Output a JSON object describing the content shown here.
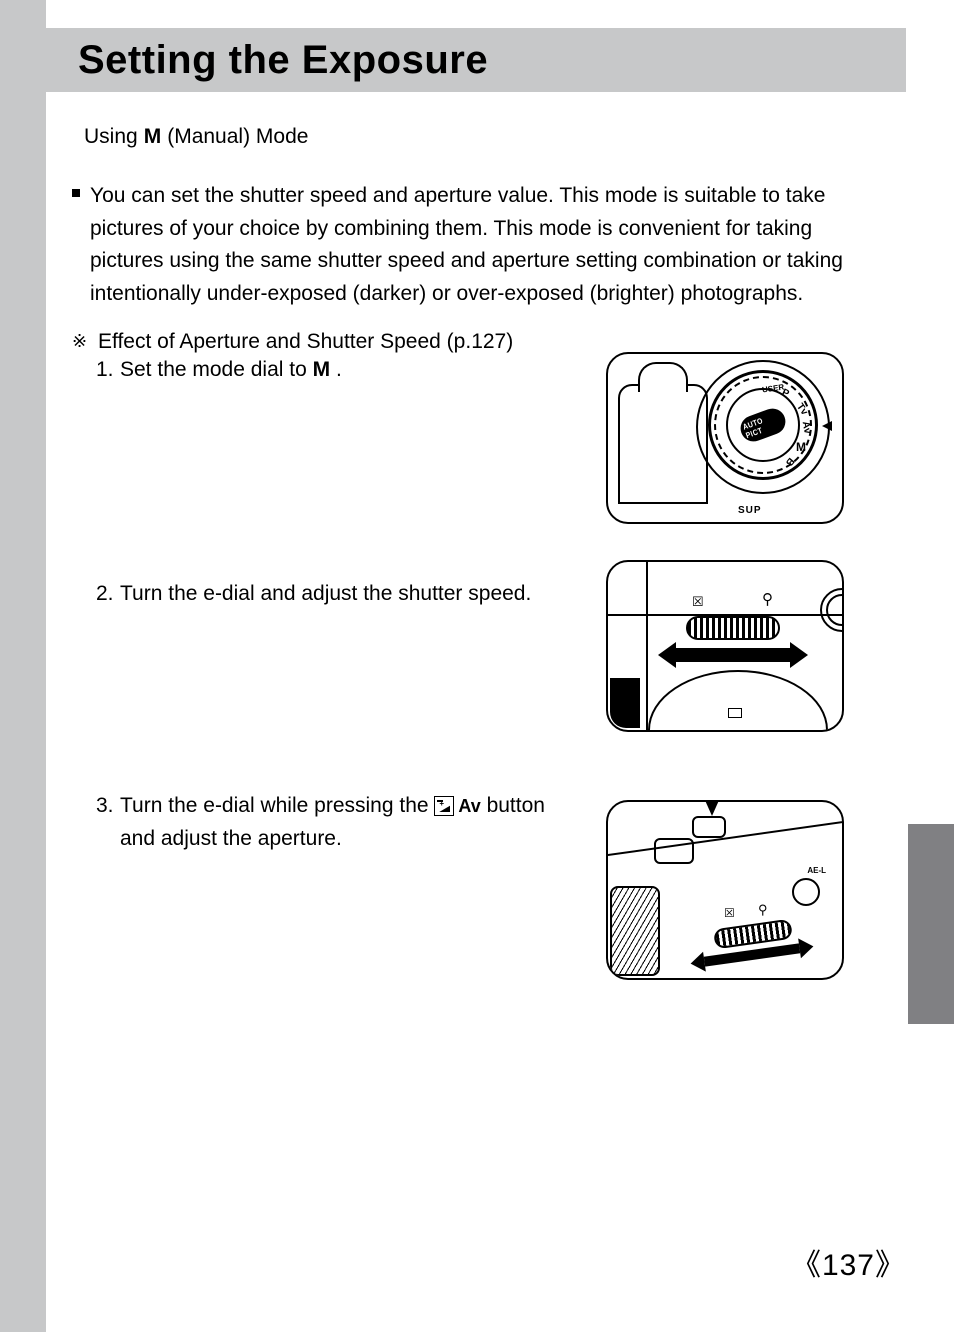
{
  "title": "Setting the Exposure",
  "subhead_prefix": "Using ",
  "subhead_mode_glyph": "M",
  "subhead_suffix": " (Manual) Mode",
  "bullet_main": "You can set the shutter speed and aperture value. This mode is suitable to take pictures of your choice by combining them. This mode is convenient for taking pictures using the same shutter speed and aperture setting combination or taking intentionally under-exposed (darker) or over-exposed (brighter) photographs.",
  "crossref_marker": "※",
  "crossref_text": "Effect of Aperture and Shutter Speed (p.127)",
  "steps": {
    "s1_num": "1.",
    "s1_a": "Set the mode dial to ",
    "s1_glyph": "M",
    "s1_b": " .",
    "s2_num": "2.",
    "s2_text": "Turn the e-dial and adjust the shutter speed.",
    "s3_num": "3.",
    "s3_a": "Turn the e-dial while pressing the ",
    "s3_av_label": "Av",
    "s3_b": " button and adjust the aperture."
  },
  "illus1": {
    "center": "AUTO PICT",
    "labels": {
      "p": "P",
      "tv": "Tv",
      "av": "Av",
      "m": "M",
      "b": "B",
      "user": "USER"
    },
    "sup": "SUP"
  },
  "illus2": {
    "mark_ev": "☒",
    "mark_loupe": "⚲"
  },
  "illus3": {
    "ael": "AE-L",
    "mark_ev": "☒",
    "mark_loupe": "⚲"
  },
  "page_number": "137",
  "page_bracket_left": "《",
  "page_bracket_right": "》"
}
